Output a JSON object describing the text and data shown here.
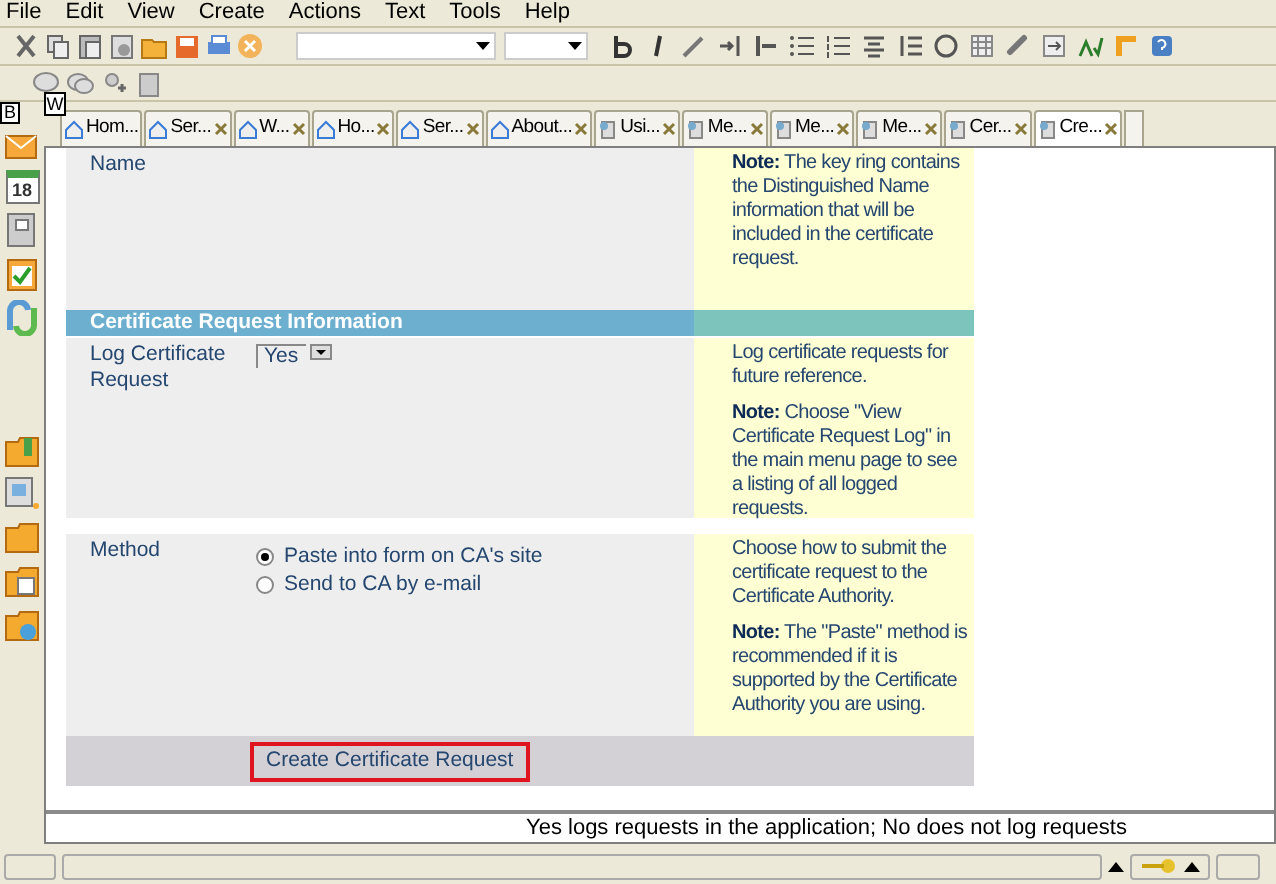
{
  "menu": [
    "File",
    "Edit",
    "View",
    "Create",
    "Actions",
    "Text",
    "Tools",
    "Help"
  ],
  "shortcut_badges": {
    "tabs": "W",
    "sidebar": "B"
  },
  "tabs": [
    {
      "label": "Hom...",
      "closable": false,
      "selected": false
    },
    {
      "label": "Ser...",
      "closable": true,
      "selected": false
    },
    {
      "label": "W...",
      "closable": true,
      "selected": false
    },
    {
      "label": "Ho...",
      "closable": true,
      "selected": false
    },
    {
      "label": "Ser...",
      "closable": true,
      "selected": false
    },
    {
      "label": "About...",
      "closable": true,
      "selected": false
    },
    {
      "label": "Usi...",
      "closable": true,
      "selected": false
    },
    {
      "label": "Me...",
      "closable": true,
      "selected": false
    },
    {
      "label": "Me...",
      "closable": true,
      "selected": false
    },
    {
      "label": "Me...",
      "closable": true,
      "selected": false
    },
    {
      "label": "Cer...",
      "closable": true,
      "selected": false
    },
    {
      "label": "Cre...",
      "closable": true,
      "selected": true
    }
  ],
  "sidebar": {
    "calendar_day": "18"
  },
  "form": {
    "name_row": {
      "label": "Name",
      "notes": [
        "**Note:** The key ring contains the Distinguished Name information that will be included in the certificate request."
      ]
    },
    "section_title": "Certificate Request Information",
    "log_row": {
      "label": "Log Certificate Request",
      "value": "Yes",
      "notes": [
        "Log certificate requests for future reference.",
        "**Note:** Choose \"View Certificate Request Log\" in the main menu page to see a listing of all logged requests."
      ]
    },
    "method_row": {
      "label": "Method",
      "options": [
        {
          "label": "Paste into form on CA's site",
          "selected": true
        },
        {
          "label": "Send to CA by e-mail",
          "selected": false
        }
      ],
      "notes": [
        "Choose how to submit the certificate request to the Certificate Authority.",
        "**Note:** The \"Paste\" method is recommended if it is supported by the Certificate Authority you are using."
      ]
    },
    "submit_button": "Create Certificate Request"
  },
  "hint": "Yes logs requests in the application; No does not log requests"
}
